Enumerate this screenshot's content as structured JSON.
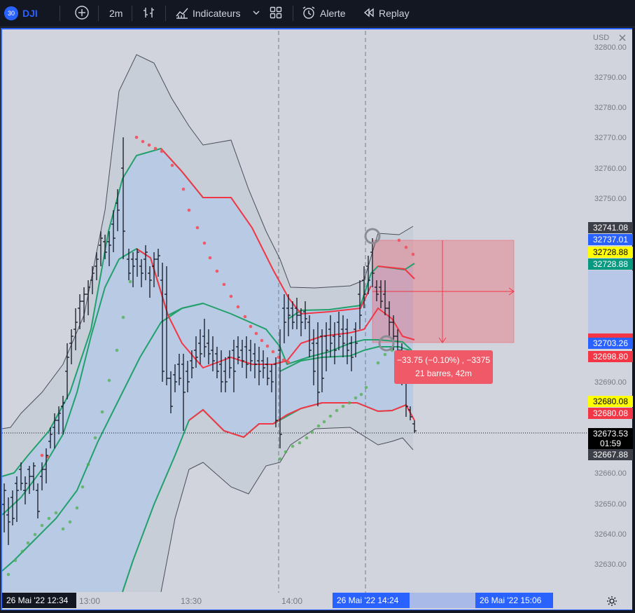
{
  "toolbar": {
    "symbol_badge": "30",
    "symbol": "DJI",
    "interval": "2m",
    "indicators_label": "Indicateurs",
    "alert_label": "Alerte",
    "replay_label": "Replay"
  },
  "axis": {
    "currency": "USD",
    "price_ticks": [
      "32800.00",
      "32790.00",
      "32780.00",
      "32770.00",
      "32760.00",
      "32750.00",
      "32690.00",
      "32660.00",
      "32650.00",
      "32640.00",
      "32630.00"
    ],
    "time_ticks": [
      "13:00",
      "13:30",
      "14:00"
    ]
  },
  "price_labels": [
    {
      "value": "32741.08",
      "bg": "#3d3f48",
      "fg": "#ffffff"
    },
    {
      "value": "32737.01",
      "bg": "#2962ff",
      "fg": "#ffffff"
    },
    {
      "value": "32728.88",
      "bg": "#ffff00",
      "fg": "#000000"
    },
    {
      "value": "32728.88",
      "bg": "#089981",
      "fg": "#ffffff"
    },
    {
      "value": "32703.26",
      "bg": "#2962ff",
      "fg": "#ffffff"
    },
    {
      "value": "32698.80",
      "bg": "#f23645",
      "fg": "#ffffff"
    },
    {
      "value": "32680.08",
      "bg": "#ffff00",
      "fg": "#000000"
    },
    {
      "value": "32680.08",
      "bg": "#f23645",
      "fg": "#ffffff"
    },
    {
      "value": "32673.53",
      "bg": "#000000",
      "fg": "#ffffff"
    },
    {
      "value": "01:59",
      "bg": "#000000",
      "fg": "#ffffff"
    },
    {
      "value": "32667.88",
      "bg": "#3d3f48",
      "fg": "#ffffff"
    }
  ],
  "time_labels": {
    "left": "26 Mai '22   12:34",
    "mid": "26 Mai '22   14:24",
    "right": "26 Mai '22   15:06"
  },
  "measure": {
    "line1": "−33.75 (−0.10%) , −3375",
    "line2": "21 barres, 42m"
  },
  "colors": {
    "accent": "#2962ff",
    "up": "#089981",
    "down": "#f23645"
  }
}
